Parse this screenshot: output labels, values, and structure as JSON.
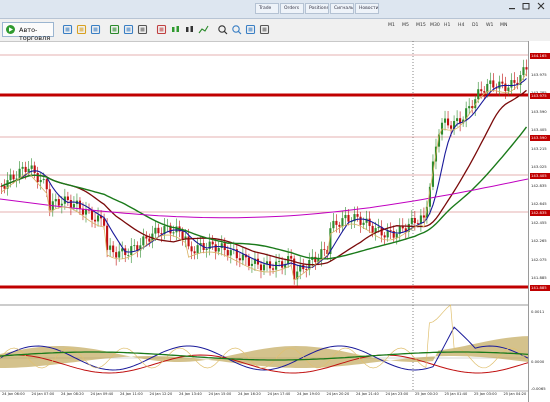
{
  "window": {
    "tabs": [
      "Trade",
      "Orders",
      "Positions",
      "Сигналы",
      "Новости"
    ]
  },
  "toolbar": {
    "algo_label": "Авто-торговля",
    "icons": [
      "new-chart-icon",
      "open-icon",
      "profiles-icon",
      "market-watch-icon",
      "navigator-icon",
      "terminal-icon",
      "tester-icon",
      "algo-trading-icon",
      "bar-chart-icon",
      "candle-chart-icon",
      "line-chart-icon",
      "zoom-in-icon",
      "zoom-out-icon",
      "tile-icon",
      "autoscroll-icon",
      "chart-shift-icon",
      "indicators-icon",
      "periods-icon",
      "templates-icon",
      "cursor-icon",
      "crosshair-icon",
      "vertical-line-icon",
      "horizontal-line-icon",
      "trendline-icon",
      "channel-icon",
      "fibonacci-icon",
      "text-icon",
      "label-icon",
      "arrows-icon"
    ],
    "timeframes": [
      "M1",
      "M5",
      "M15",
      "M30",
      "H1",
      "H4",
      "D1",
      "W1",
      "MN"
    ]
  },
  "price_axis": {
    "ticks": [
      "144.165",
      "143.975",
      "143.785",
      "143.590",
      "143.405",
      "143.215",
      "143.025",
      "142.835",
      "142.645",
      "142.455",
      "142.265",
      "142.075",
      "141.885"
    ],
    "levels": [
      {
        "label": "144.165",
        "color": "#c00000"
      },
      {
        "label": "143.975",
        "color": "#c00000"
      },
      {
        "label": "143.590",
        "color": "#c00000"
      },
      {
        "label": "143.405",
        "color": "#c00000"
      },
      {
        "label": "142.835",
        "color": "#c00000"
      },
      {
        "label": "141.885",
        "color": "#c00000"
      }
    ]
  },
  "indicator_axis": {
    "ticks": [
      "0.0011",
      "0.0000",
      "-0.0065"
    ]
  },
  "time_axis": {
    "labels": [
      "24 Jan 06:00",
      "24 Jan 07:00",
      "24 Jan 08:20",
      "24 Jan 09:40",
      "24 Jan 11:00",
      "24 Jan 12:20",
      "24 Jan 13:40",
      "24 Jan 15:00",
      "24 Jan 16:20",
      "24 Jan 17:40",
      "24 Jan 19:00",
      "24 Jan 20:20",
      "24 Jan 21:40",
      "24 Jan 23:00",
      "25 Jan 00:20",
      "25 Jan 01:40",
      "25 Jan 03:00",
      "25 Jan 04:20"
    ]
  },
  "colors": {
    "candle_up": "#2e8b2e",
    "candle_down": "#c01010",
    "ma_fast": "#1a1a9a",
    "ma_mid": "#7a0a0a",
    "ma_slow": "#1a7a1a",
    "ma_long": "#c000c0",
    "level_line": "#c00000",
    "fill_band": "#b89a40"
  }
}
